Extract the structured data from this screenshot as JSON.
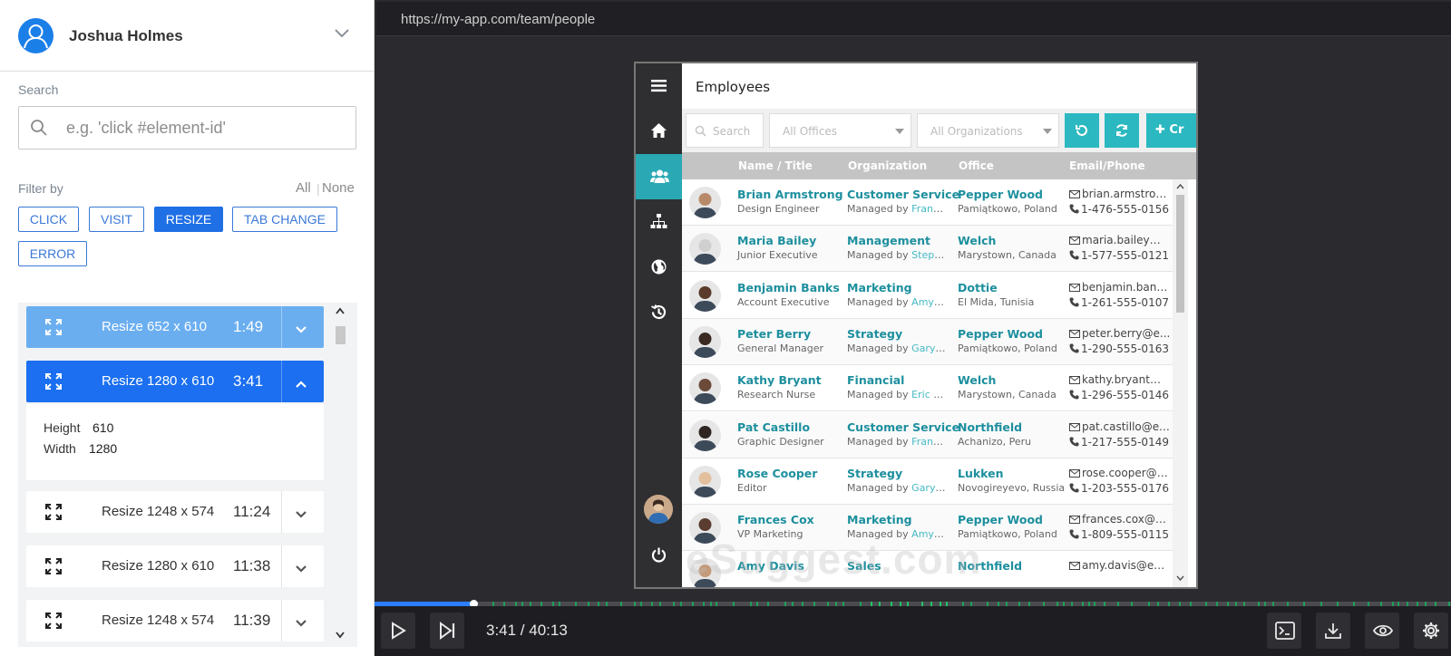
{
  "user": {
    "name": "Joshua Holmes"
  },
  "search": {
    "label": "Search",
    "placeholder": "e.g. 'click #element-id'"
  },
  "filter": {
    "label": "Filter by",
    "all": "All",
    "none": "None",
    "chips": [
      {
        "label": "CLICK",
        "active": false
      },
      {
        "label": "VISIT",
        "active": false
      },
      {
        "label": "RESIZE",
        "active": true
      },
      {
        "label": "TAB CHANGE",
        "active": false
      },
      {
        "label": "ERROR",
        "active": false
      }
    ]
  },
  "events": [
    {
      "label": "Resize 652 x 610",
      "time": "1:49",
      "state": "light",
      "icon": "resize-icon"
    },
    {
      "label": "Resize 1280 x 610",
      "time": "3:41",
      "state": "selected",
      "icon": "resize-icon"
    },
    {
      "label": "Resize 1248 x 574",
      "time": "11:24",
      "state": "normal",
      "icon": "resize-icon"
    },
    {
      "label": "Resize 1280 x 610",
      "time": "11:38",
      "state": "normal",
      "icon": "resize-icon"
    },
    {
      "label": "Resize 1248 x 574",
      "time": "11:39",
      "state": "normal",
      "icon": "resize-icon"
    }
  ],
  "event_detail": {
    "height_label": "Height",
    "height_value": "610",
    "width_label": "Width",
    "width_value": "1280"
  },
  "player": {
    "url": "https://my-app.com/team/people",
    "time_display": "3:41 / 40:13",
    "progress_fraction": 0.092
  },
  "app": {
    "title": "Employees",
    "toolbar": {
      "search_placeholder": "Search",
      "offices_placeholder": "All Offices",
      "orgs_placeholder": "All Organizations",
      "create_label": "Cr"
    },
    "columns": [
      "Name / Title",
      "Organization",
      "Office",
      "Email/Phone"
    ],
    "rows": [
      {
        "name": "Brian Armstrong",
        "title": "Design Engineer",
        "org": "Customer Service",
        "mgr_prefix": "Managed by ",
        "mgr": "France...",
        "office": "Pepper Wood",
        "loc": "Pamiątkowo, Poland",
        "email": "brian.armstron...",
        "phone": "1-476-555-0156"
      },
      {
        "name": "Maria Bailey",
        "title": "Junior Executive",
        "org": "Management",
        "mgr_prefix": "Managed by ",
        "mgr": "Steph...",
        "office": "Welch",
        "loc": "Marystown, Canada",
        "email": "maria.bailey@...",
        "phone": "1-577-555-0121"
      },
      {
        "name": "Benjamin Banks",
        "title": "Account Executive",
        "org": "Marketing",
        "mgr_prefix": "Managed by ",
        "mgr": "Amy D...",
        "office": "Dottie",
        "loc": "El Mida, Tunisia",
        "email": "benjamin.bank...",
        "phone": "1-261-555-0107"
      },
      {
        "name": "Peter Berry",
        "title": "General Manager",
        "org": "Strategy",
        "mgr_prefix": "Managed by ",
        "mgr": "Gary R...",
        "office": "Pepper Wood",
        "loc": "Pamiątkowo, Poland",
        "email": "peter.berry@e...",
        "phone": "1-290-555-0163"
      },
      {
        "name": "Kathy Bryant",
        "title": "Research Nurse",
        "org": "Financial",
        "mgr_prefix": "Managed by ",
        "mgr": "Eric W...",
        "office": "Welch",
        "loc": "Marystown, Canada",
        "email": "kathy.bryant@...",
        "phone": "1-296-555-0146"
      },
      {
        "name": "Pat Castillo",
        "title": "Graphic Designer",
        "org": "Customer Service",
        "mgr_prefix": "Managed by ",
        "mgr": "France...",
        "office": "Northfield",
        "loc": "Achanizo, Peru",
        "email": "pat.castillo@ex...",
        "phone": "1-217-555-0149"
      },
      {
        "name": "Rose Cooper",
        "title": "Editor",
        "org": "Strategy",
        "mgr_prefix": "Managed by ",
        "mgr": "Gary R...",
        "office": "Lukken",
        "loc": "Novogireyevo, Russia",
        "email": "rose.cooper@e...",
        "phone": "1-203-555-0176"
      },
      {
        "name": "Frances Cox",
        "title": "VP Marketing",
        "org": "Marketing",
        "mgr_prefix": "Managed by ",
        "mgr": "Amy D...",
        "office": "Pepper Wood",
        "loc": "Pamiątkowo, Poland",
        "email": "frances.cox@e...",
        "phone": "1-809-555-0115"
      },
      {
        "name": "Amy Davis",
        "title": "",
        "org": "Sales",
        "mgr_prefix": "",
        "mgr": "",
        "office": "Northfield",
        "loc": "",
        "email": "amy.davis@ext...",
        "phone": ""
      }
    ],
    "watermark": "eSuggest.com"
  },
  "colors": {
    "accent": "#1f6fe5",
    "teal": "#2bb8c0",
    "link": "#1d8f9e"
  }
}
